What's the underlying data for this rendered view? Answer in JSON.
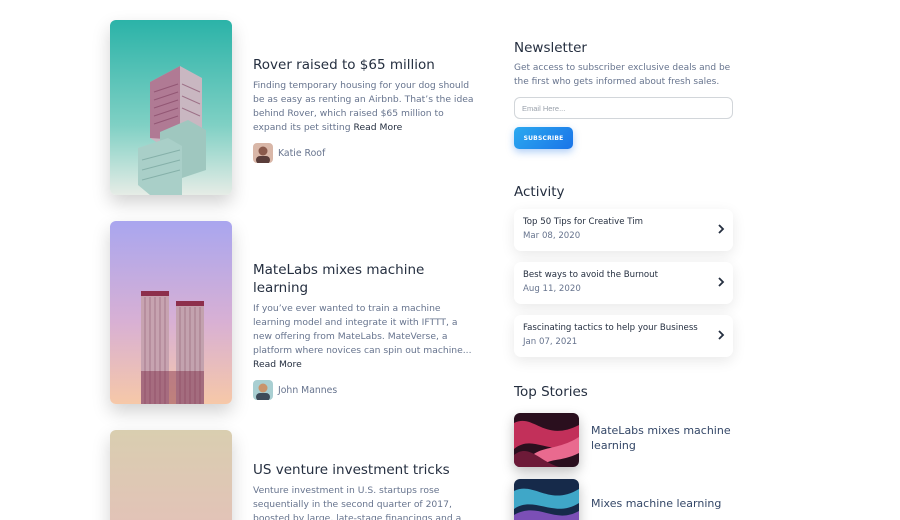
{
  "articles": [
    {
      "title": "Rover raised to $65 million",
      "text": "Finding temporary housing for your dog should be as easy as renting an Airbnb. That’s the idea behind Rover, which raised $65 million to expand its pet sitting",
      "read_more": "Read More",
      "author": "Katie Roof",
      "image_icon": "teal-building-image"
    },
    {
      "title": "MateLabs mixes machine learning",
      "text": "If you’ve ever wanted to train a machine learning model and integrate it with IFTTT, a new offering from MateLabs. MateVerse, a platform where novices can spin out machine...",
      "read_more": "Read More",
      "author": "John Mannes",
      "image_icon": "twin-towers-image"
    },
    {
      "title": "US venture investment tricks",
      "text": "Venture investment in U.S. startups rose sequentially in the second quarter of 2017, boosted by large, late-stage financings and a few outsized early-stage rounds in",
      "image_icon": "sand-gradient-image"
    }
  ],
  "newsletter": {
    "title": "Newsletter",
    "text": "Get access to subscriber exclusive deals and be the first who gets informed about fresh sales.",
    "placeholder": "Email Here...",
    "button": "SUBSCRIBE"
  },
  "activity": {
    "title": "Activity",
    "items": [
      {
        "title": "Top 50 Tips for Creative Tim",
        "date": "Mar 08, 2020"
      },
      {
        "title": "Best ways to avoid the Burnout",
        "date": "Aug 11, 2020"
      },
      {
        "title": "Fascinating tactics to help your Business",
        "date": "Jan 07, 2021"
      }
    ]
  },
  "top_stories": {
    "title": "Top Stories",
    "items": [
      {
        "title": "MateLabs mixes machine learning"
      },
      {
        "title": "Mixes machine learning"
      }
    ]
  },
  "colors": {
    "accent_button": "#1a74e8",
    "heading": "#252f40",
    "body_text": "#67748e"
  }
}
